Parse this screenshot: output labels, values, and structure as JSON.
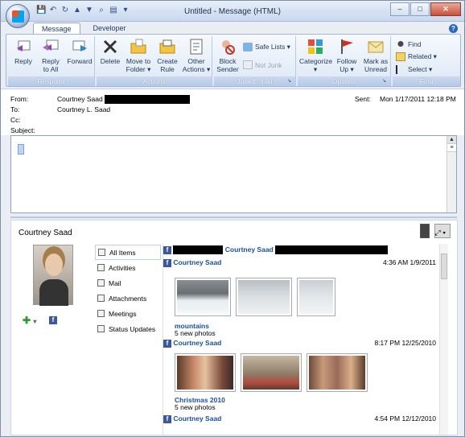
{
  "window": {
    "title": "Untitled - Message (HTML)",
    "controls": [
      "–",
      "□",
      "✕"
    ]
  },
  "tabs": [
    "Message",
    "Developer"
  ],
  "ribbon": {
    "respond": {
      "label": "Respond",
      "reply": "Reply",
      "reply_all": "Reply\nto All",
      "forward": "Forward"
    },
    "actions": {
      "label": "Actions",
      "delete": "Delete",
      "move": "Move to\nFolder ▾",
      "rule": "Create\nRule",
      "other": "Other\nActions ▾"
    },
    "junk": {
      "label": "Junk E-mail",
      "block": "Block\nSender",
      "safe": "Safe Lists ▾",
      "notjunk": "Not Junk"
    },
    "options": {
      "label": "Options",
      "categorize": "Categorize\n▾",
      "followup": "Follow\nUp ▾",
      "markunread": "Mark as\nUnread"
    },
    "find": {
      "label": "Find",
      "find": "Find",
      "related": "Related ▾",
      "select": "Select ▾"
    }
  },
  "header": {
    "from_label": "From:",
    "from": "Courtney Saad",
    "to_label": "To:",
    "to": "Courtney L. Saad",
    "cc_label": "Cc:",
    "subject_label": "Subject:",
    "sent_label": "Sent:",
    "sent": "Mon 1/17/2011 12:18 PM"
  },
  "social": {
    "person": "Courtney Saad",
    "nav": [
      "All Items",
      "Activities",
      "Mail",
      "Attachments",
      "Meetings",
      "Status Updates"
    ],
    "feed": [
      {
        "name": "Courtney Saad",
        "time": ""
      },
      {
        "name": "Courtney Saad",
        "time": "4:36 AM 1/9/2011",
        "album": "mountains",
        "count": "5 new photos"
      },
      {
        "name": "Courtney Saad",
        "time": "8:17 PM 12/25/2010",
        "album": "Christmas 2010",
        "count": "5 new photos"
      },
      {
        "name": "Courtney Saad",
        "time": "4:54 PM 12/12/2010"
      }
    ]
  }
}
